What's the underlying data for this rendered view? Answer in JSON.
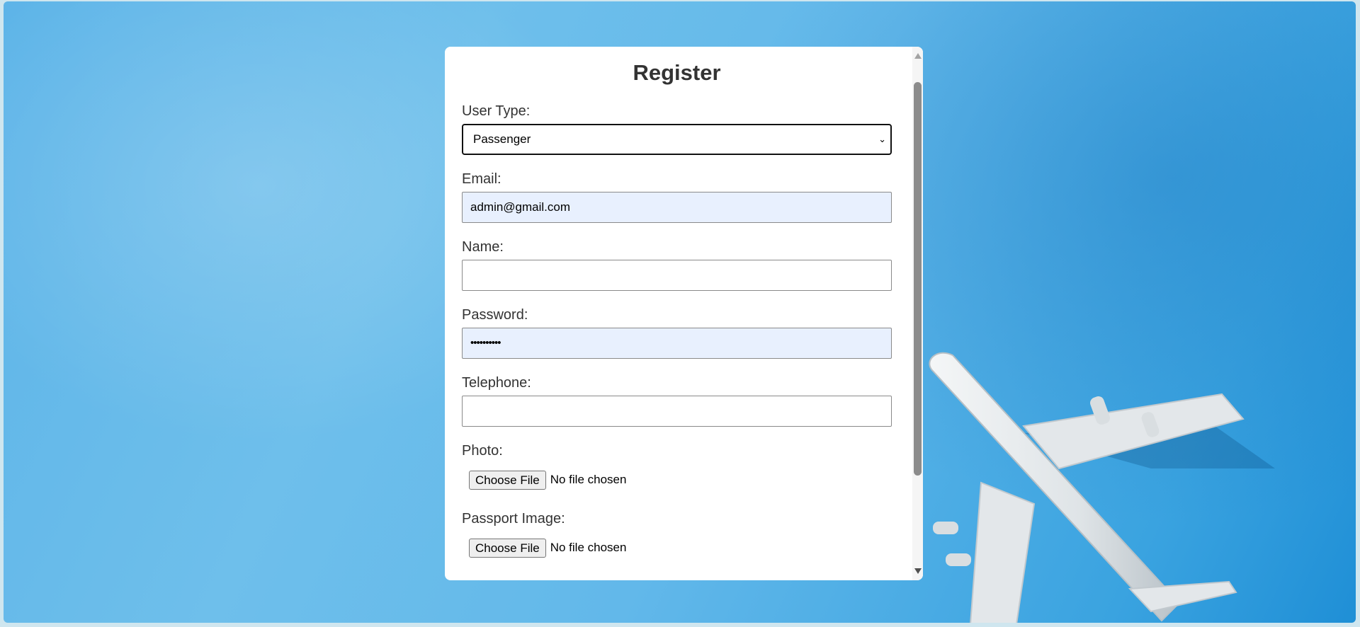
{
  "form": {
    "title": "Register",
    "user_type": {
      "label": "User Type:",
      "selected": "Passenger"
    },
    "email": {
      "label": "Email:",
      "value": "admin@gmail.com"
    },
    "name": {
      "label": "Name:",
      "value": ""
    },
    "password": {
      "label": "Password:",
      "value": "••••••••••"
    },
    "telephone": {
      "label": "Telephone:",
      "value": ""
    },
    "photo": {
      "label": "Photo:",
      "button": "Choose File",
      "status": "No file chosen"
    },
    "passport_image": {
      "label": "Passport Image:",
      "button": "Choose File",
      "status": "No file chosen"
    }
  },
  "icons": {
    "select_arrow": "chevron-down-icon",
    "background_image": "airplane-illustration"
  },
  "colors": {
    "background_blue": "#62b8ea",
    "autofill_bg": "#e8f0fe",
    "card_bg": "#ffffff",
    "text": "#333333"
  }
}
